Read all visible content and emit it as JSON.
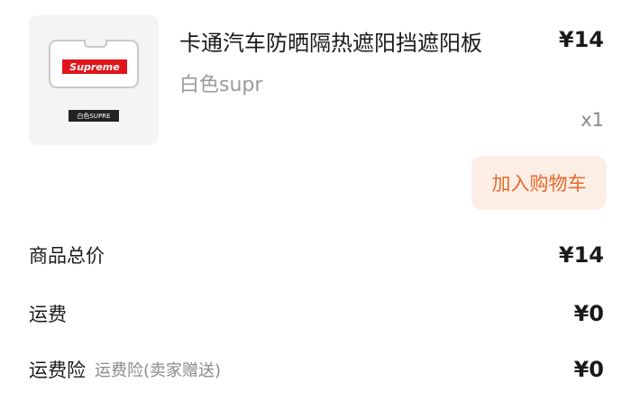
{
  "product": {
    "image_logo": "Supreme",
    "image_tag": "白色SUPRE",
    "title": "卡通汽车防晒隔热遮阳挡遮阳板",
    "variant": "白色supr",
    "price": "¥14",
    "quantity": "x1",
    "add_to_cart_label": "加入购物车"
  },
  "summary": {
    "subtotal_label": "商品总价",
    "subtotal_value": "¥14",
    "shipping_label": "运费",
    "shipping_value": "¥0",
    "insurance_label": "运费险",
    "insurance_note": "运费险(卖家赠送)",
    "insurance_value": "¥0"
  },
  "colors": {
    "accent": "#e56a2c",
    "accent_bg": "#fdeee5",
    "logo_red": "#e0151c"
  }
}
